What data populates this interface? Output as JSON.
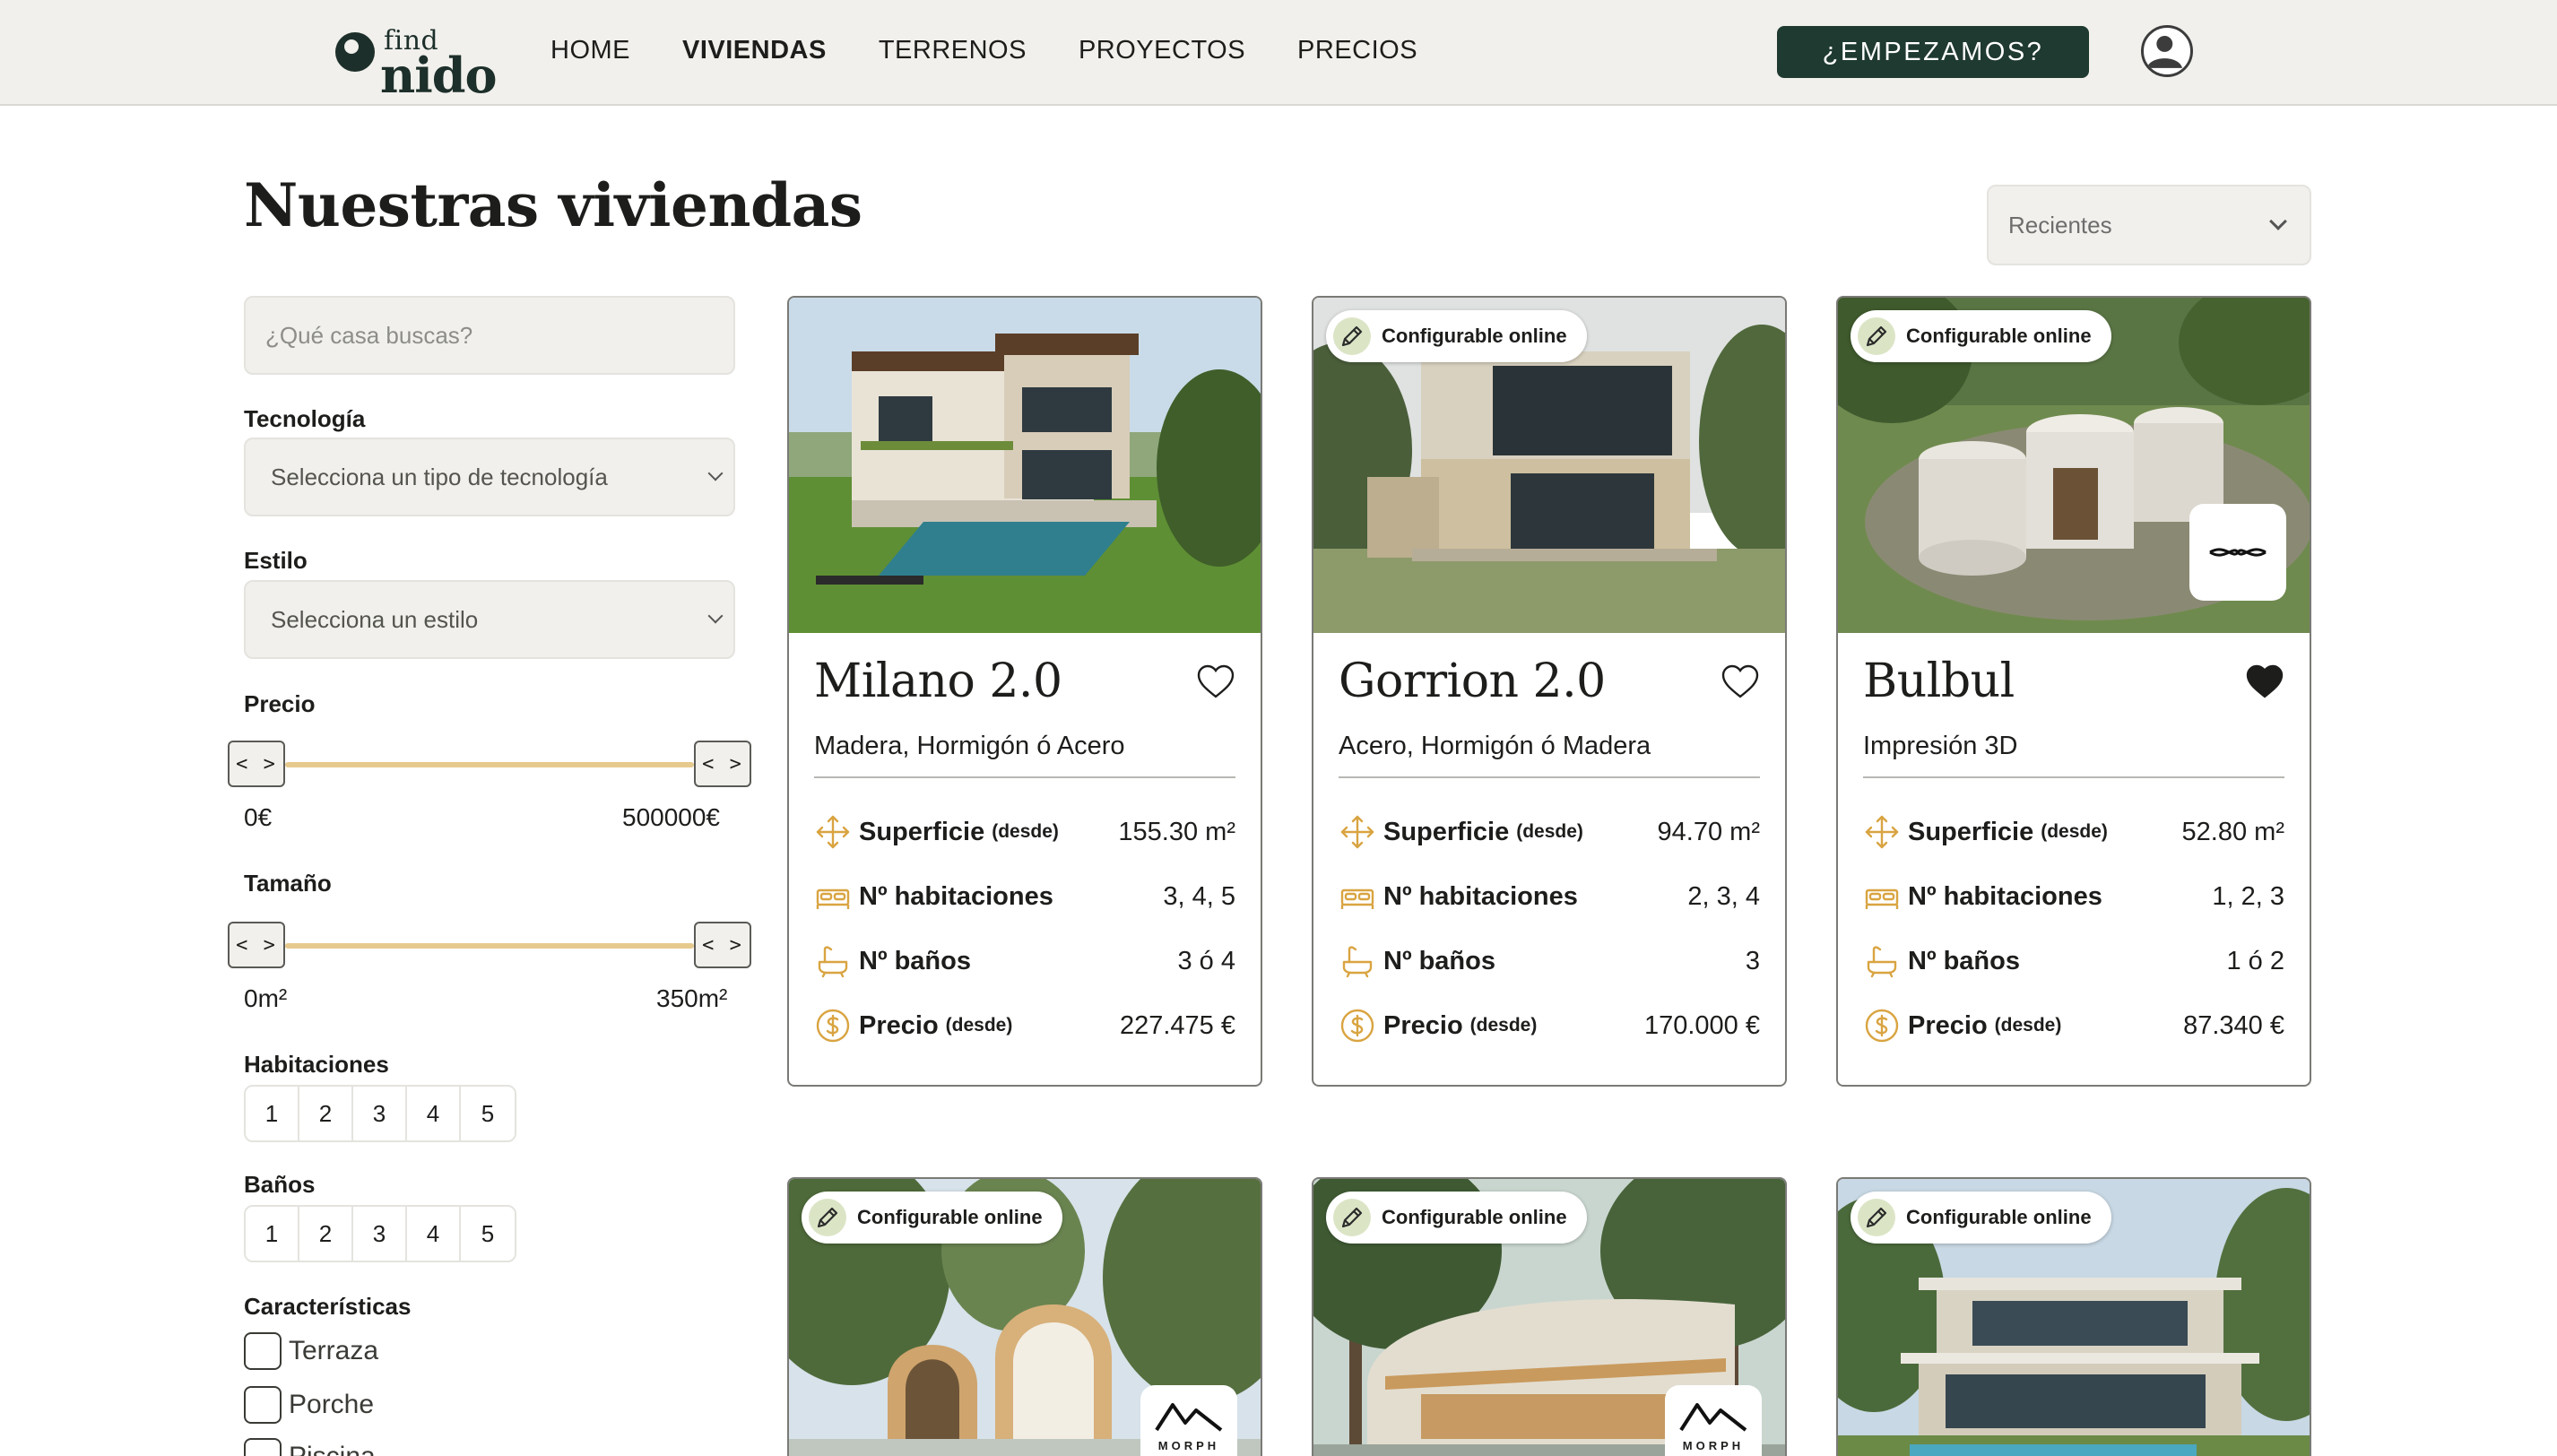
{
  "header": {
    "logo": {
      "top": "find",
      "bottom": "nido"
    },
    "nav": [
      "HOME",
      "VIVIENDAS",
      "TERRENOS",
      "PROYECTOS",
      "PRECIOS"
    ],
    "active_nav": "VIVIENDAS",
    "cta_label": "¿EMPEZAMOS?"
  },
  "page_title": "Nuestras viviendas",
  "sort": {
    "selected": "Recientes"
  },
  "filters": {
    "search_placeholder": "¿Qué casa buscas?",
    "technology": {
      "label": "Tecnología",
      "placeholder": "Selecciona un tipo de tecnología"
    },
    "style": {
      "label": "Estilo",
      "placeholder": "Selecciona un estilo"
    },
    "price": {
      "label": "Precio",
      "min": "0€",
      "max": "500000€",
      "handle": "< >"
    },
    "size": {
      "label": "Tamaño",
      "min": "0m²",
      "max": "350m²",
      "handle": "< >"
    },
    "rooms": {
      "label": "Habitaciones",
      "options": [
        "1",
        "2",
        "3",
        "4",
        "5"
      ]
    },
    "baths": {
      "label": "Baños",
      "options": [
        "1",
        "2",
        "3",
        "4",
        "5"
      ]
    },
    "features": {
      "label": "Características",
      "options": [
        "Terraza",
        "Porche",
        "Piscina"
      ]
    }
  },
  "card_labels": {
    "surface": "Superficie",
    "rooms": "Nº habitaciones",
    "baths": "Nº baños",
    "price": "Precio",
    "from_note": "(desde)",
    "configurable_badge": "Configurable online"
  },
  "cards": [
    {
      "name": "Milano 2.0",
      "materials": "Madera, Hormigón ó Acero",
      "surface": "155.30 m²",
      "rooms": "3, 4, 5",
      "baths": "3 ó 4",
      "price": "227.475 €",
      "configurable": false,
      "favorite": false
    },
    {
      "name": "Gorrion 2.0",
      "materials": "Acero, Hormigón ó Madera",
      "surface": "94.70 m²",
      "rooms": "2, 3, 4",
      "baths": "3",
      "price": "170.000 €",
      "configurable": true,
      "favorite": false
    },
    {
      "name": "Bulbul",
      "materials": "Impresión 3D",
      "surface": "52.80 m²",
      "rooms": "1, 2, 3",
      "baths": "1 ó 2",
      "price": "87.340 €",
      "configurable": true,
      "favorite": true
    },
    {
      "configurable": true,
      "brand": "MORPH"
    },
    {
      "configurable": true,
      "brand": "MORPH"
    },
    {
      "configurable": true
    }
  ],
  "colors": {
    "header_bg": "#f1f0ec",
    "cta_bg": "#1f3a30",
    "slider_track": "#e6c98d",
    "icon_gold": "#d9a441",
    "badge_icon_bg": "#dbe5c6"
  }
}
